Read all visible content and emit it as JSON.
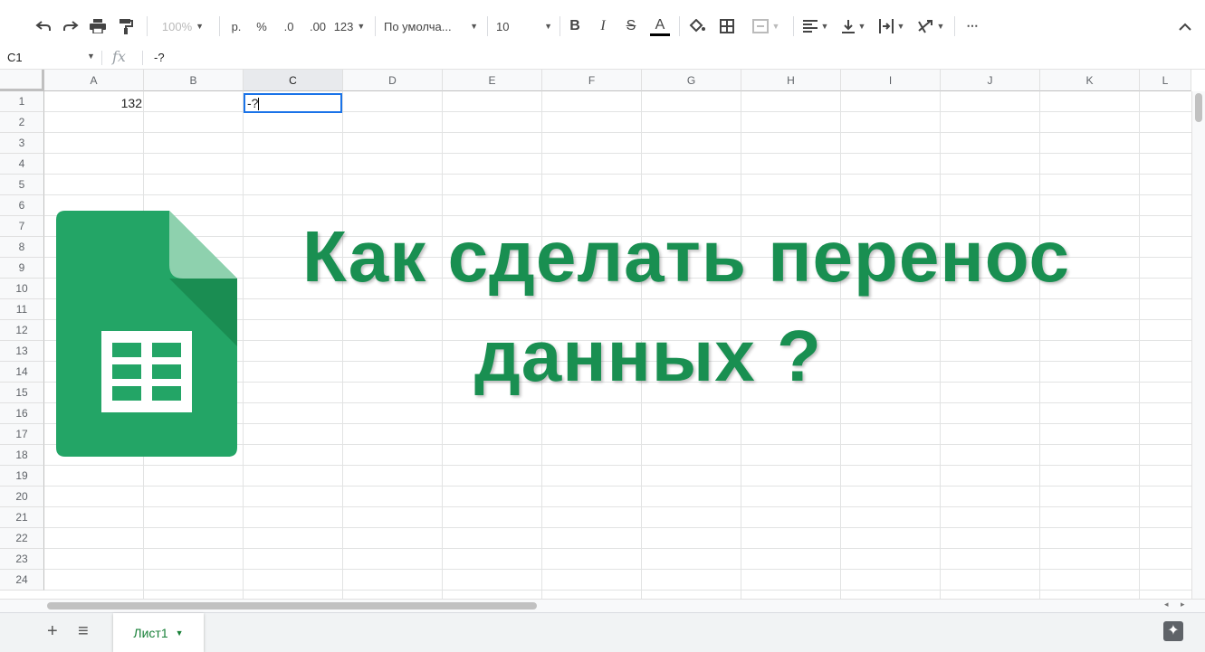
{
  "toolbar": {
    "zoom": "100%",
    "currency": "р.",
    "percent": "%",
    "dec_decrease": ".0",
    "dec_increase": ".00",
    "format_more": "123",
    "font": "По умолча...",
    "font_size": "10",
    "bold": "B",
    "italic": "I",
    "strike": "S",
    "text_color": "A",
    "more": "⋯"
  },
  "formula_bar": {
    "name_box": "C1",
    "fx": "fx",
    "value": "-?"
  },
  "columns": [
    "A",
    "B",
    "C",
    "D",
    "E",
    "F",
    "G",
    "H",
    "I",
    "J",
    "K",
    "L"
  ],
  "rows": [
    "1",
    "2",
    "3",
    "4",
    "5",
    "6",
    "7",
    "8",
    "9",
    "10",
    "11",
    "12",
    "13",
    "14",
    "15",
    "16",
    "17",
    "18",
    "19",
    "20",
    "21",
    "22",
    "23",
    "24"
  ],
  "cells": {
    "A1": "132",
    "C1": "-?"
  },
  "sheet": {
    "add": "+",
    "list": "≡",
    "tab_label": "Лист1"
  },
  "overlay": {
    "line1": "Как сделать перенос",
    "line2": "данных ?",
    "color": "#198f51"
  },
  "colors": {
    "accent": "#1a73e8",
    "sheets_green": "#23a566"
  }
}
